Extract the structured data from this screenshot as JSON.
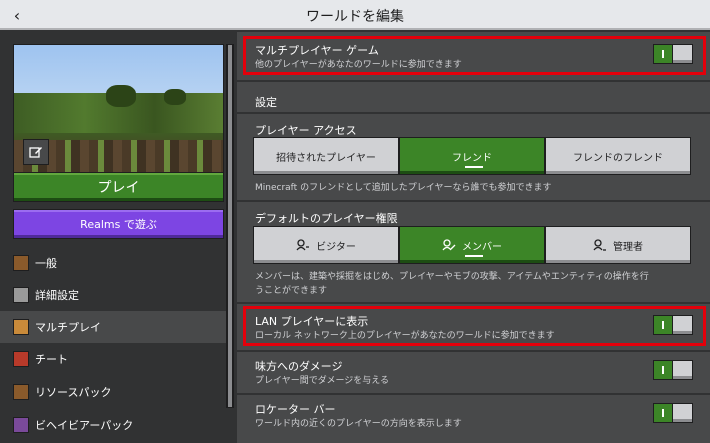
{
  "header": {
    "title": "ワールドを編集",
    "back_icon": "chevron-left-icon"
  },
  "left": {
    "play_label": "プレイ",
    "realms_label": "Realms で遊ぶ",
    "nav": [
      {
        "label": "一般",
        "icon": "general-icon",
        "color": "#8a5a2b",
        "selected": false
      },
      {
        "label": "詳細設定",
        "icon": "advanced-icon",
        "color": "#9a9a9a",
        "selected": false
      },
      {
        "label": "マルチプレイ",
        "icon": "multiplayer-icon",
        "color": "#c98a3a",
        "selected": true
      },
      {
        "label": "チート",
        "icon": "cheats-icon",
        "color": "#b83a2a",
        "selected": false
      },
      {
        "label": "リソースパック",
        "icon": "resource-pack-icon",
        "color": "#8a5a2b",
        "selected": false
      },
      {
        "label": "ビヘイビアーパック",
        "icon": "behavior-pack-icon",
        "color": "#7a4a9a",
        "selected": false
      }
    ]
  },
  "right": {
    "multiplayer": {
      "title": "マルチプレイヤー ゲーム",
      "subtitle": "他のプレイヤーがあなたのワールドに参加できます",
      "on": true
    },
    "settings_label": "設定",
    "player_access": {
      "title": "プレイヤー アクセス",
      "options": [
        "招待されたプレイヤー",
        "フレンド",
        "フレンドのフレンド"
      ],
      "selected_index": 1,
      "description": "Minecraft のフレンドとして追加したプレイヤーなら誰でも参加できます"
    },
    "default_permission": {
      "title": "デフォルトのプレイヤー権限",
      "options": [
        "ビジター",
        "メンバー",
        "管理者"
      ],
      "selected_index": 1,
      "description_line1": "メンバーは、建築や採掘をはじめ、プレイヤーやモブの攻撃、アイテムやエンティティの操作を行",
      "description_line2": "うことができます"
    },
    "lan": {
      "title": "LAN プレイヤーに表示",
      "subtitle": "ローカル ネットワーク上のプレイヤーがあなたのワールドに参加できます",
      "on": true
    },
    "friendly_fire": {
      "title": "味方へのダメージ",
      "subtitle": "プレイヤー間でダメージを与える",
      "on": true
    },
    "locator_bar": {
      "title": "ロケーター バー",
      "subtitle": "ワールド内の近くのプレイヤーの方向を表示します",
      "on": true
    }
  },
  "colors": {
    "green": "#3c8527",
    "purple": "#7d45e3",
    "highlight": "#e3000b",
    "panel": "#48494a",
    "background": "#313233"
  }
}
